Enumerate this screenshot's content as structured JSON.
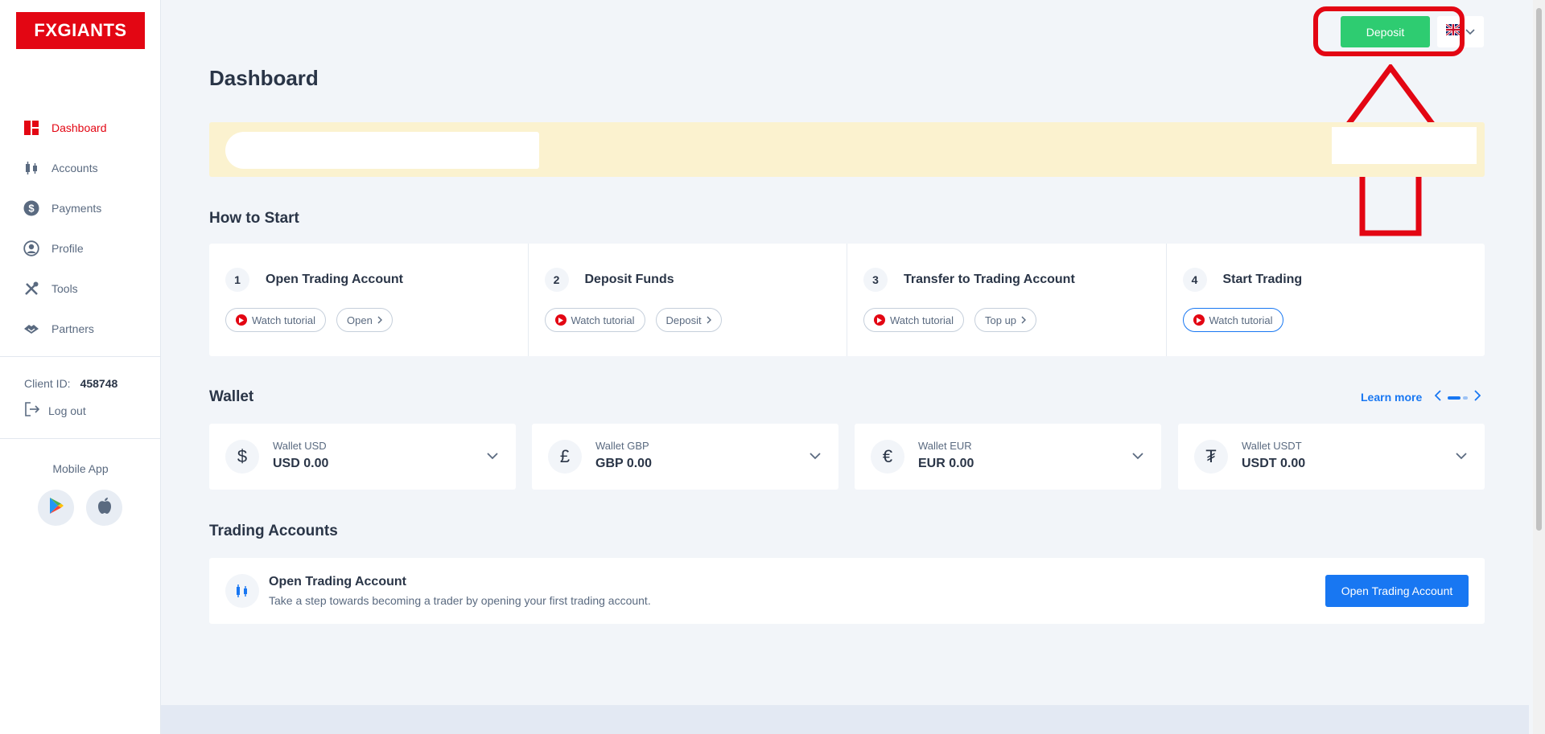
{
  "brand": {
    "logo_text": "FXGIANTS"
  },
  "sidebar": {
    "items": [
      {
        "label": "Dashboard",
        "icon": "dashboard-icon",
        "active": true
      },
      {
        "label": "Accounts",
        "icon": "candlestick-icon"
      },
      {
        "label": "Payments",
        "icon": "dollar-icon"
      },
      {
        "label": "Profile",
        "icon": "user-icon"
      },
      {
        "label": "Tools",
        "icon": "tools-icon"
      },
      {
        "label": "Partners",
        "icon": "handshake-icon"
      }
    ],
    "client_id_label": "Client ID:",
    "client_id": "458748",
    "logout_label": "Log out",
    "mobile_app_label": "Mobile App"
  },
  "topbar": {
    "deposit_label": "Deposit",
    "language_icon": "uk-flag-icon"
  },
  "page": {
    "title": "Dashboard"
  },
  "how_to_start": {
    "title": "How to Start",
    "steps": [
      {
        "num": "1",
        "title": "Open Trading Account",
        "tutorial": "Watch tutorial",
        "action": "Open"
      },
      {
        "num": "2",
        "title": "Deposit Funds",
        "tutorial": "Watch tutorial",
        "action": "Deposit"
      },
      {
        "num": "3",
        "title": "Transfer to Trading Account",
        "tutorial": "Watch tutorial",
        "action": "Top up"
      },
      {
        "num": "4",
        "title": "Start Trading",
        "tutorial": "Watch tutorial"
      }
    ]
  },
  "wallet": {
    "title": "Wallet",
    "learn_more": "Learn more",
    "cards": [
      {
        "symbol": "$",
        "name": "Wallet USD",
        "value": "USD 0.00"
      },
      {
        "symbol": "£",
        "name": "Wallet GBP",
        "value": "GBP 0.00"
      },
      {
        "symbol": "€",
        "name": "Wallet EUR",
        "value": "EUR 0.00"
      },
      {
        "symbol": "₮",
        "name": "Wallet USDT",
        "value": "USDT 0.00"
      }
    ]
  },
  "trading_accounts": {
    "title": "Trading Accounts",
    "card_title": "Open Trading Account",
    "card_desc": "Take a step towards becoming a trader by opening your first trading account.",
    "button_label": "Open Trading Account"
  },
  "colors": {
    "brand_red": "#e30613",
    "deposit_green": "#2ecc71",
    "primary_blue": "#1877f2"
  }
}
